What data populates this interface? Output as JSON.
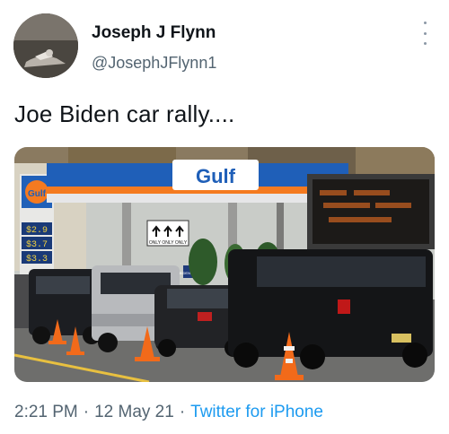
{
  "tweet": {
    "author_name": "Joseph J Flynn",
    "author_handle": "@JosephJFlynn1",
    "text": "Joe Biden car rally....",
    "time": "2:21 PM",
    "separator": "·",
    "date": "12 May 21",
    "source": "Twitter for iPhone"
  },
  "photo_signage": {
    "station_brand": "Gulf",
    "side_brand": "Gulf",
    "traffic_sign": "ONLY ONLY ONLY",
    "campaign_sign": "BIDEN HARRIS",
    "price_digits": [
      "$2.9",
      "$3.7",
      "$3.3"
    ]
  },
  "colors": {
    "link": "#1d9bf0",
    "secondary_text": "#536471",
    "primary_text": "#0f1419",
    "gulf_blue": "#1f5fb8",
    "gulf_orange": "#f47a20"
  },
  "icons": {
    "more": "more-vertical-icon"
  }
}
